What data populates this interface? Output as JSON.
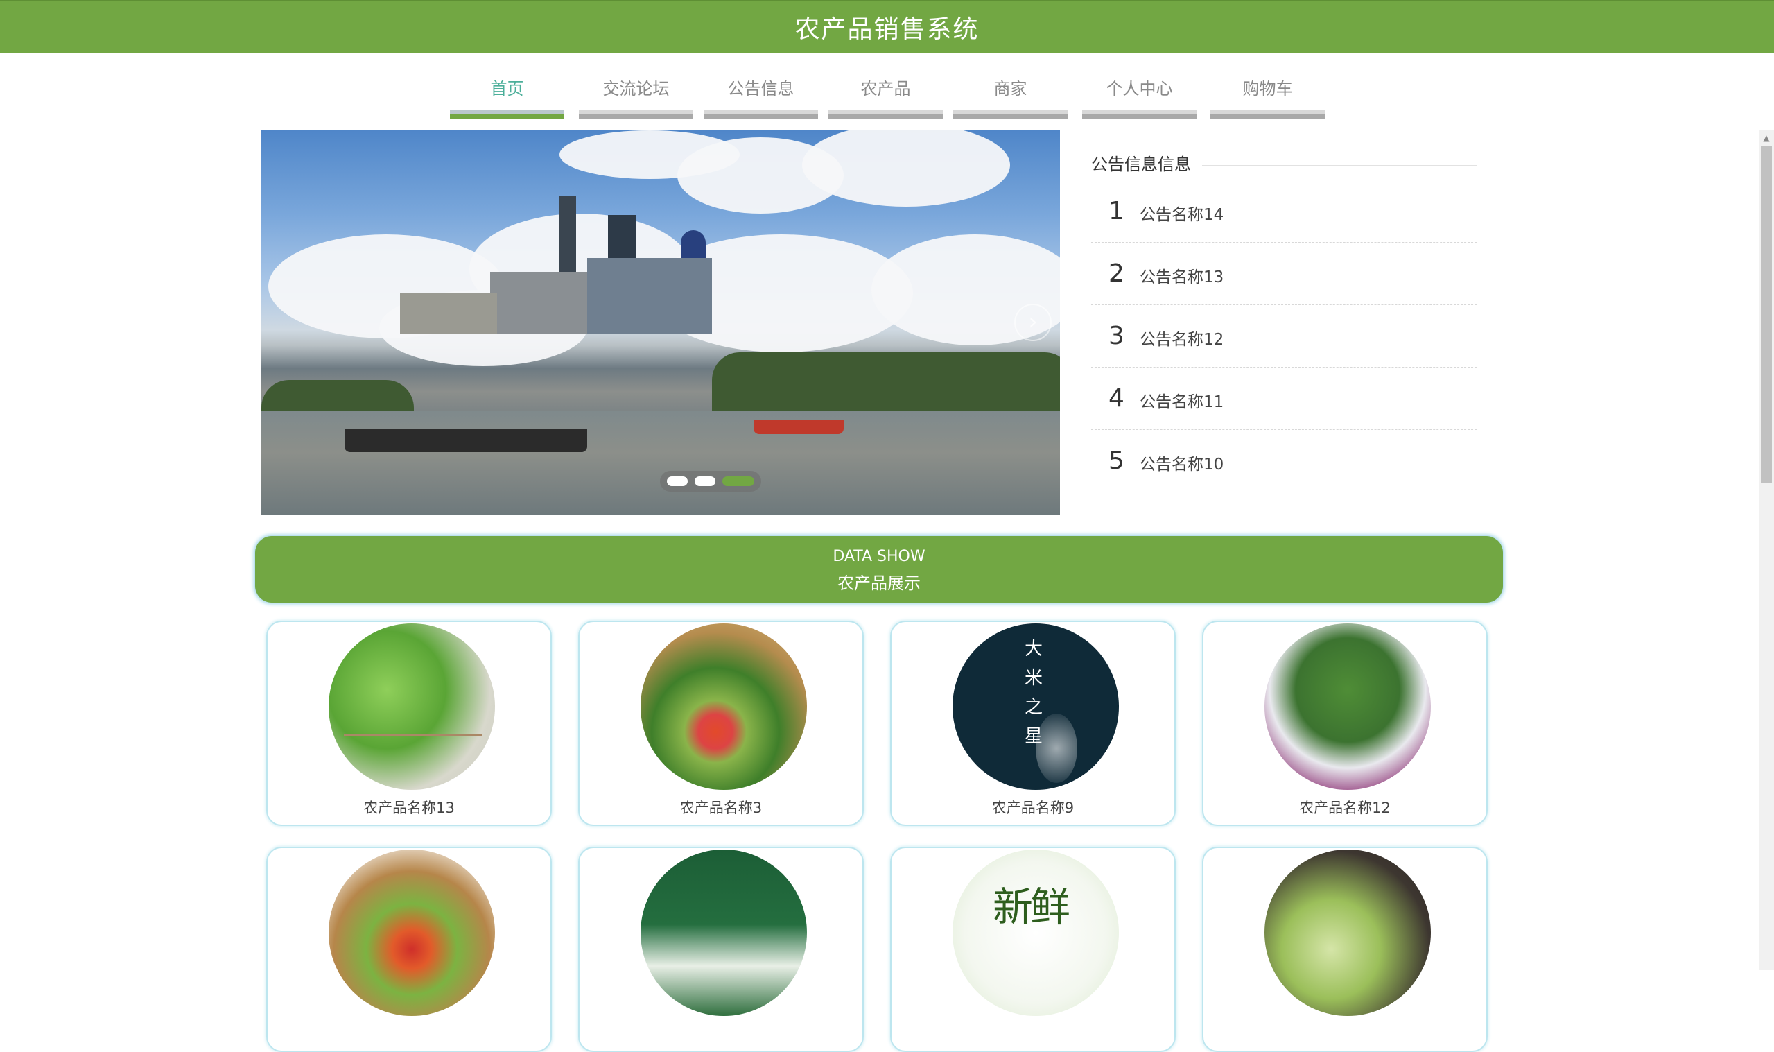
{
  "header": {
    "title": "农产品销售系统"
  },
  "nav": {
    "items": [
      {
        "label": "首页",
        "active": true
      },
      {
        "label": "交流论坛"
      },
      {
        "label": "公告信息"
      },
      {
        "label": "农产品"
      },
      {
        "label": "商家"
      },
      {
        "label": "个人中心"
      },
      {
        "label": "购物车"
      }
    ],
    "colors": {
      "active_text": "#4caf9a",
      "active_bar": "#72a743"
    }
  },
  "carousel": {
    "image": "city-skyline-river",
    "next_icon": "chevron-right-icon",
    "slide_count": 3,
    "active_index": 2
  },
  "notice": {
    "title": "公告信息信息",
    "items": [
      {
        "num": "1",
        "text": "公告名称14"
      },
      {
        "num": "2",
        "text": "公告名称13"
      },
      {
        "num": "3",
        "text": "公告名称12"
      },
      {
        "num": "4",
        "text": "公告名称11"
      },
      {
        "num": "5",
        "text": "公告名称10"
      }
    ]
  },
  "band": {
    "en": "DATA SHOW",
    "zh": "农产品展示"
  },
  "products": [
    {
      "name": "农产品名称13",
      "image": "cabbage"
    },
    {
      "name": "农产品名称3",
      "image": "vegetable-basket"
    },
    {
      "name": "农产品名称9",
      "image": "rice-star"
    },
    {
      "name": "农产品名称12",
      "image": "mixed-vegetables"
    },
    {
      "name": "",
      "image": "produce-basket"
    },
    {
      "name": "",
      "image": "packaged-goods"
    },
    {
      "name": "",
      "image": "fresh-vegetables"
    },
    {
      "name": "",
      "image": "napa-cabbage"
    }
  ],
  "product_image_text": {
    "rice": [
      "大",
      "米",
      "之",
      "星"
    ],
    "fresh": "新鲜"
  },
  "theme": {
    "primary": "#72a743",
    "card_border": "#bde6ef"
  }
}
